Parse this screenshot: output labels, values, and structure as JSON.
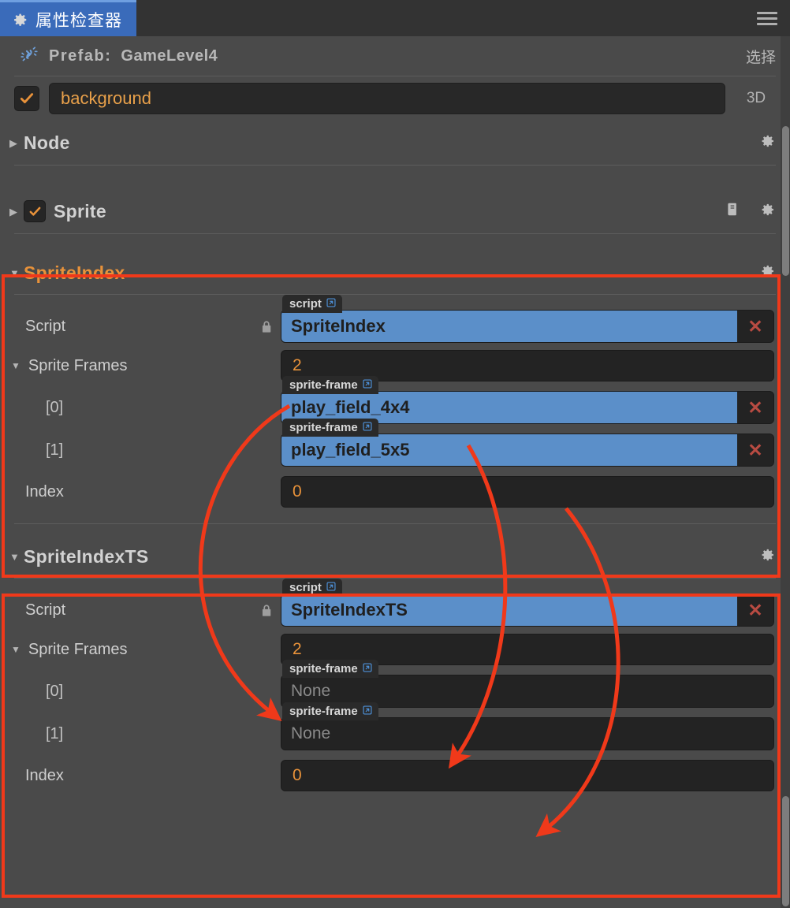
{
  "window": {
    "tab_label": "属性检查器",
    "tab_icon": "gear-icon",
    "menu_icon": "hamburger-menu-icon"
  },
  "prefab": {
    "icon": "prefab-unlink-icon",
    "label": "Prefab:",
    "name": "GameLevel4",
    "select_label": "选择"
  },
  "node": {
    "enabled_checkbox": true,
    "name": "background",
    "mode_label": "3D"
  },
  "components": [
    {
      "title": "Node",
      "expanded": false,
      "has_checkbox": false,
      "accent": false,
      "icons": [
        "gear-icon"
      ]
    },
    {
      "title": "Sprite",
      "expanded": false,
      "has_checkbox": true,
      "checked": true,
      "accent": false,
      "icons": [
        "help-book-icon",
        "gear-icon"
      ]
    }
  ],
  "sections": [
    {
      "title": "SpriteIndex",
      "accent": true,
      "expanded": true,
      "gear_icon": "gear-icon",
      "script_row": {
        "label": "Script",
        "lock_icon": "lock-icon",
        "tag": "script",
        "tag_icon": "external-link-icon",
        "value": "SpriteIndex",
        "remove_icon": "✕"
      },
      "array_row": {
        "label": "Sprite Frames",
        "count": "2"
      },
      "items": [
        {
          "label": "[0]",
          "tag": "sprite-frame",
          "tag_icon": "external-link-icon",
          "value": "play_field_4x4",
          "empty": false,
          "remove_icon": "✕"
        },
        {
          "label": "[1]",
          "tag": "sprite-frame",
          "tag_icon": "external-link-icon",
          "value": "play_field_5x5",
          "empty": false,
          "remove_icon": "✕"
        }
      ],
      "index_row": {
        "label": "Index",
        "value": "0"
      }
    },
    {
      "title": "SpriteIndexTS",
      "accent": false,
      "expanded": true,
      "gear_icon": "gear-icon",
      "script_row": {
        "label": "Script",
        "lock_icon": "lock-icon",
        "tag": "script",
        "tag_icon": "external-link-icon",
        "value": "SpriteIndexTS",
        "remove_icon": "✕"
      },
      "array_row": {
        "label": "Sprite Frames",
        "count": "2"
      },
      "items": [
        {
          "label": "[0]",
          "tag": "sprite-frame",
          "tag_icon": "external-link-icon",
          "value": "None",
          "empty": true,
          "remove_icon": ""
        },
        {
          "label": "[1]",
          "tag": "sprite-frame",
          "tag_icon": "external-link-icon",
          "value": "None",
          "empty": true,
          "remove_icon": ""
        }
      ],
      "index_row": {
        "label": "Index",
        "value": "0"
      }
    }
  ],
  "colors": {
    "accent_orange": "#e8923a",
    "asset_blue": "#5b8fc9",
    "annotation_red": "#f0391a",
    "tab_blue": "#3a6bba",
    "panel_bg": "#4a4a4a"
  },
  "annotations": {
    "highlight_count": 2,
    "arrow_count": 3
  }
}
